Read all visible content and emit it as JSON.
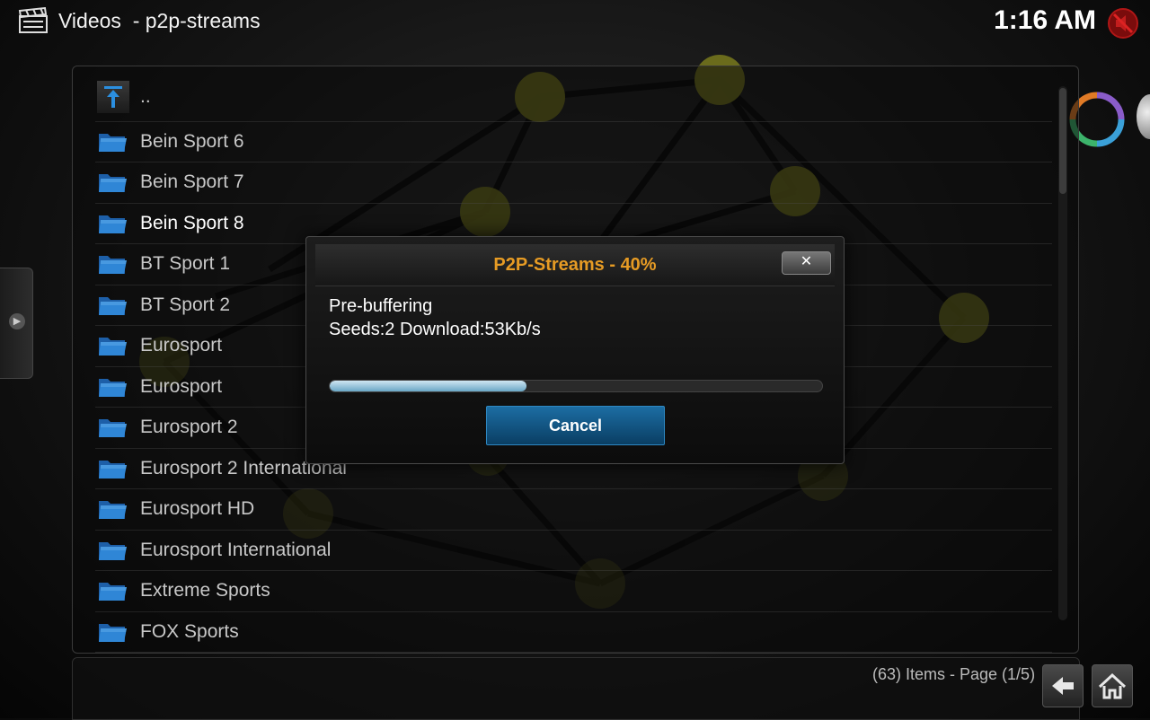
{
  "header": {
    "title": "Videos  - p2p-streams",
    "clock": "1:16 AM"
  },
  "list": {
    "parent_label": "..",
    "items": [
      {
        "label": "Bein Sport 6"
      },
      {
        "label": "Bein Sport 7"
      },
      {
        "label": "Bein Sport 8"
      },
      {
        "label": "BT Sport 1"
      },
      {
        "label": "BT Sport 2"
      },
      {
        "label": "Eurosport"
      },
      {
        "label": "Eurosport"
      },
      {
        "label": "Eurosport 2"
      },
      {
        "label": "Eurosport 2 International"
      },
      {
        "label": "Eurosport HD"
      },
      {
        "label": "Eurosport International"
      },
      {
        "label": "Extreme Sports"
      },
      {
        "label": "FOX Sports"
      }
    ]
  },
  "footer": {
    "items_count": "(63) Items - Page (1/5)"
  },
  "dialog": {
    "title": "P2P-Streams - 40%",
    "close_label": "✕",
    "line1": "Pre-buffering",
    "line2": "Seeds:2 Download:53Kb/s",
    "progress": 0.4,
    "cancel_label": "Cancel"
  },
  "colors": {
    "accent_orange": "#e69b24",
    "button_blue": "#1c6da3",
    "folder_blue": "#2a78c8",
    "node_olive": "#7a7a1e"
  },
  "icons": {
    "title": "clapperboard-icon",
    "mute": "mute-speaker-icon",
    "folder": "folder-icon",
    "parent": "parent-folder-icon",
    "back": "back-arrow-icon",
    "home": "home-icon",
    "sync": "sync-arrows-icon"
  }
}
